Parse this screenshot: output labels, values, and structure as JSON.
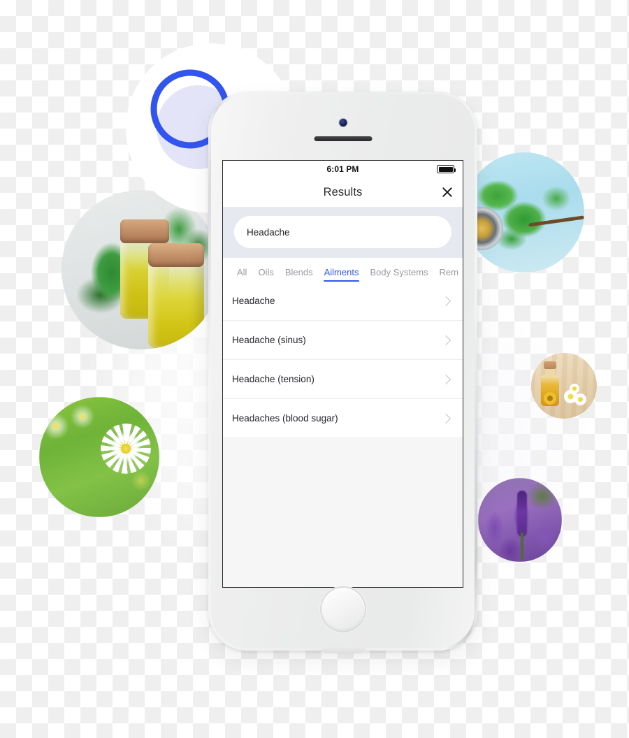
{
  "badge": {
    "icon": "search-icon",
    "accent_color": "#3355ef",
    "lens_fill_color": "#e3e4f7"
  },
  "phone": {
    "frame_color": "#eceded",
    "elements": [
      "front-camera",
      "earpiece-speaker",
      "home-button"
    ]
  },
  "screen": {
    "status_bar": {
      "time": "6:01 PM",
      "battery_icon": "battery-full-icon"
    },
    "nav_bar": {
      "title": "Results",
      "close_icon": "close-icon"
    },
    "search": {
      "value": "Headache",
      "placeholder": "Search",
      "background_color": "#e7e9f1"
    },
    "tabs": {
      "active_index": 3,
      "active_color": "#3355ef",
      "inactive_color": "#9a9aa1",
      "items": [
        {
          "label": "All"
        },
        {
          "label": "Oils"
        },
        {
          "label": "Blends"
        },
        {
          "label": "Ailments"
        },
        {
          "label": "Body Systems"
        },
        {
          "label": "Rem"
        }
      ]
    },
    "results": {
      "rows": [
        {
          "label": "Headache",
          "chevron": "chevron-right-icon"
        },
        {
          "label": "Headache (sinus)",
          "chevron": "chevron-right-icon"
        },
        {
          "label": "Headache (tension)",
          "chevron": "chevron-right-icon"
        },
        {
          "label": "Headaches (blood sugar)",
          "chevron": "chevron-right-icon"
        }
      ]
    }
  },
  "decorations": [
    {
      "name": "essential-oil-bottles-photo",
      "subject": "two glass bottles of yellow essential oil with cork stoppers and mint leaves"
    },
    {
      "name": "mint-leaves-photo",
      "subject": "fresh green mint leaves on a light blue surface"
    },
    {
      "name": "chamomile-field-photo",
      "subject": "white chamomile daisies in green grass"
    },
    {
      "name": "amber-oil-bottle-photo",
      "subject": "small amber oil bottle with cork and chamomile flowers on wood"
    },
    {
      "name": "lavender-photo",
      "subject": "purple lavender flower spikes"
    }
  ]
}
